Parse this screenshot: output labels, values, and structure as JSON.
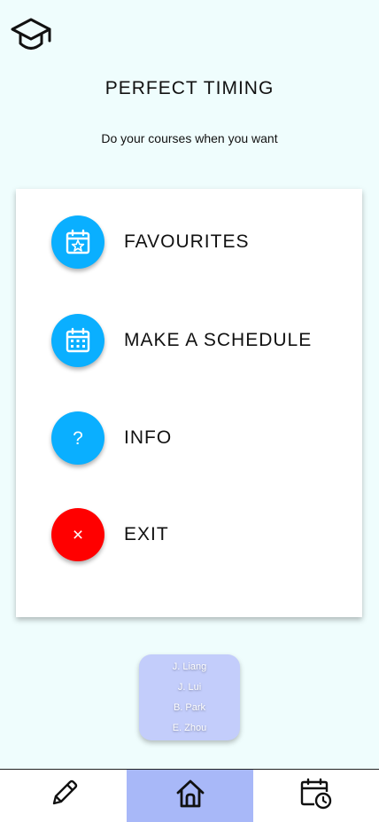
{
  "app": {
    "title": "PERFECT TIMING",
    "subtitle": "Do your courses when you want"
  },
  "colors": {
    "background": "#effdfd",
    "primary_button": "#0aafff",
    "exit_button": "#ff0000",
    "credits_bg": "#c3cdfb",
    "active_tab": "#a8b8f8"
  },
  "menu": {
    "items": [
      {
        "label": "FAVOURITES",
        "icon": "calendar-star-icon"
      },
      {
        "label": "MAKE A SCHEDULE",
        "icon": "calendar-icon"
      },
      {
        "label": "INFO",
        "icon": "question-icon",
        "glyph": "?"
      },
      {
        "label": "EXIT",
        "icon": "close-icon",
        "glyph": "×"
      }
    ]
  },
  "credits": {
    "names": [
      "J. Liang",
      "J. Lui",
      "B. Park",
      "E. Zhou"
    ]
  },
  "bottom_nav": {
    "tabs": [
      {
        "name": "edit",
        "icon": "pencil-icon",
        "active": false
      },
      {
        "name": "home",
        "icon": "home-icon",
        "active": true
      },
      {
        "name": "schedule",
        "icon": "calendar-clock-icon",
        "active": false
      }
    ]
  }
}
